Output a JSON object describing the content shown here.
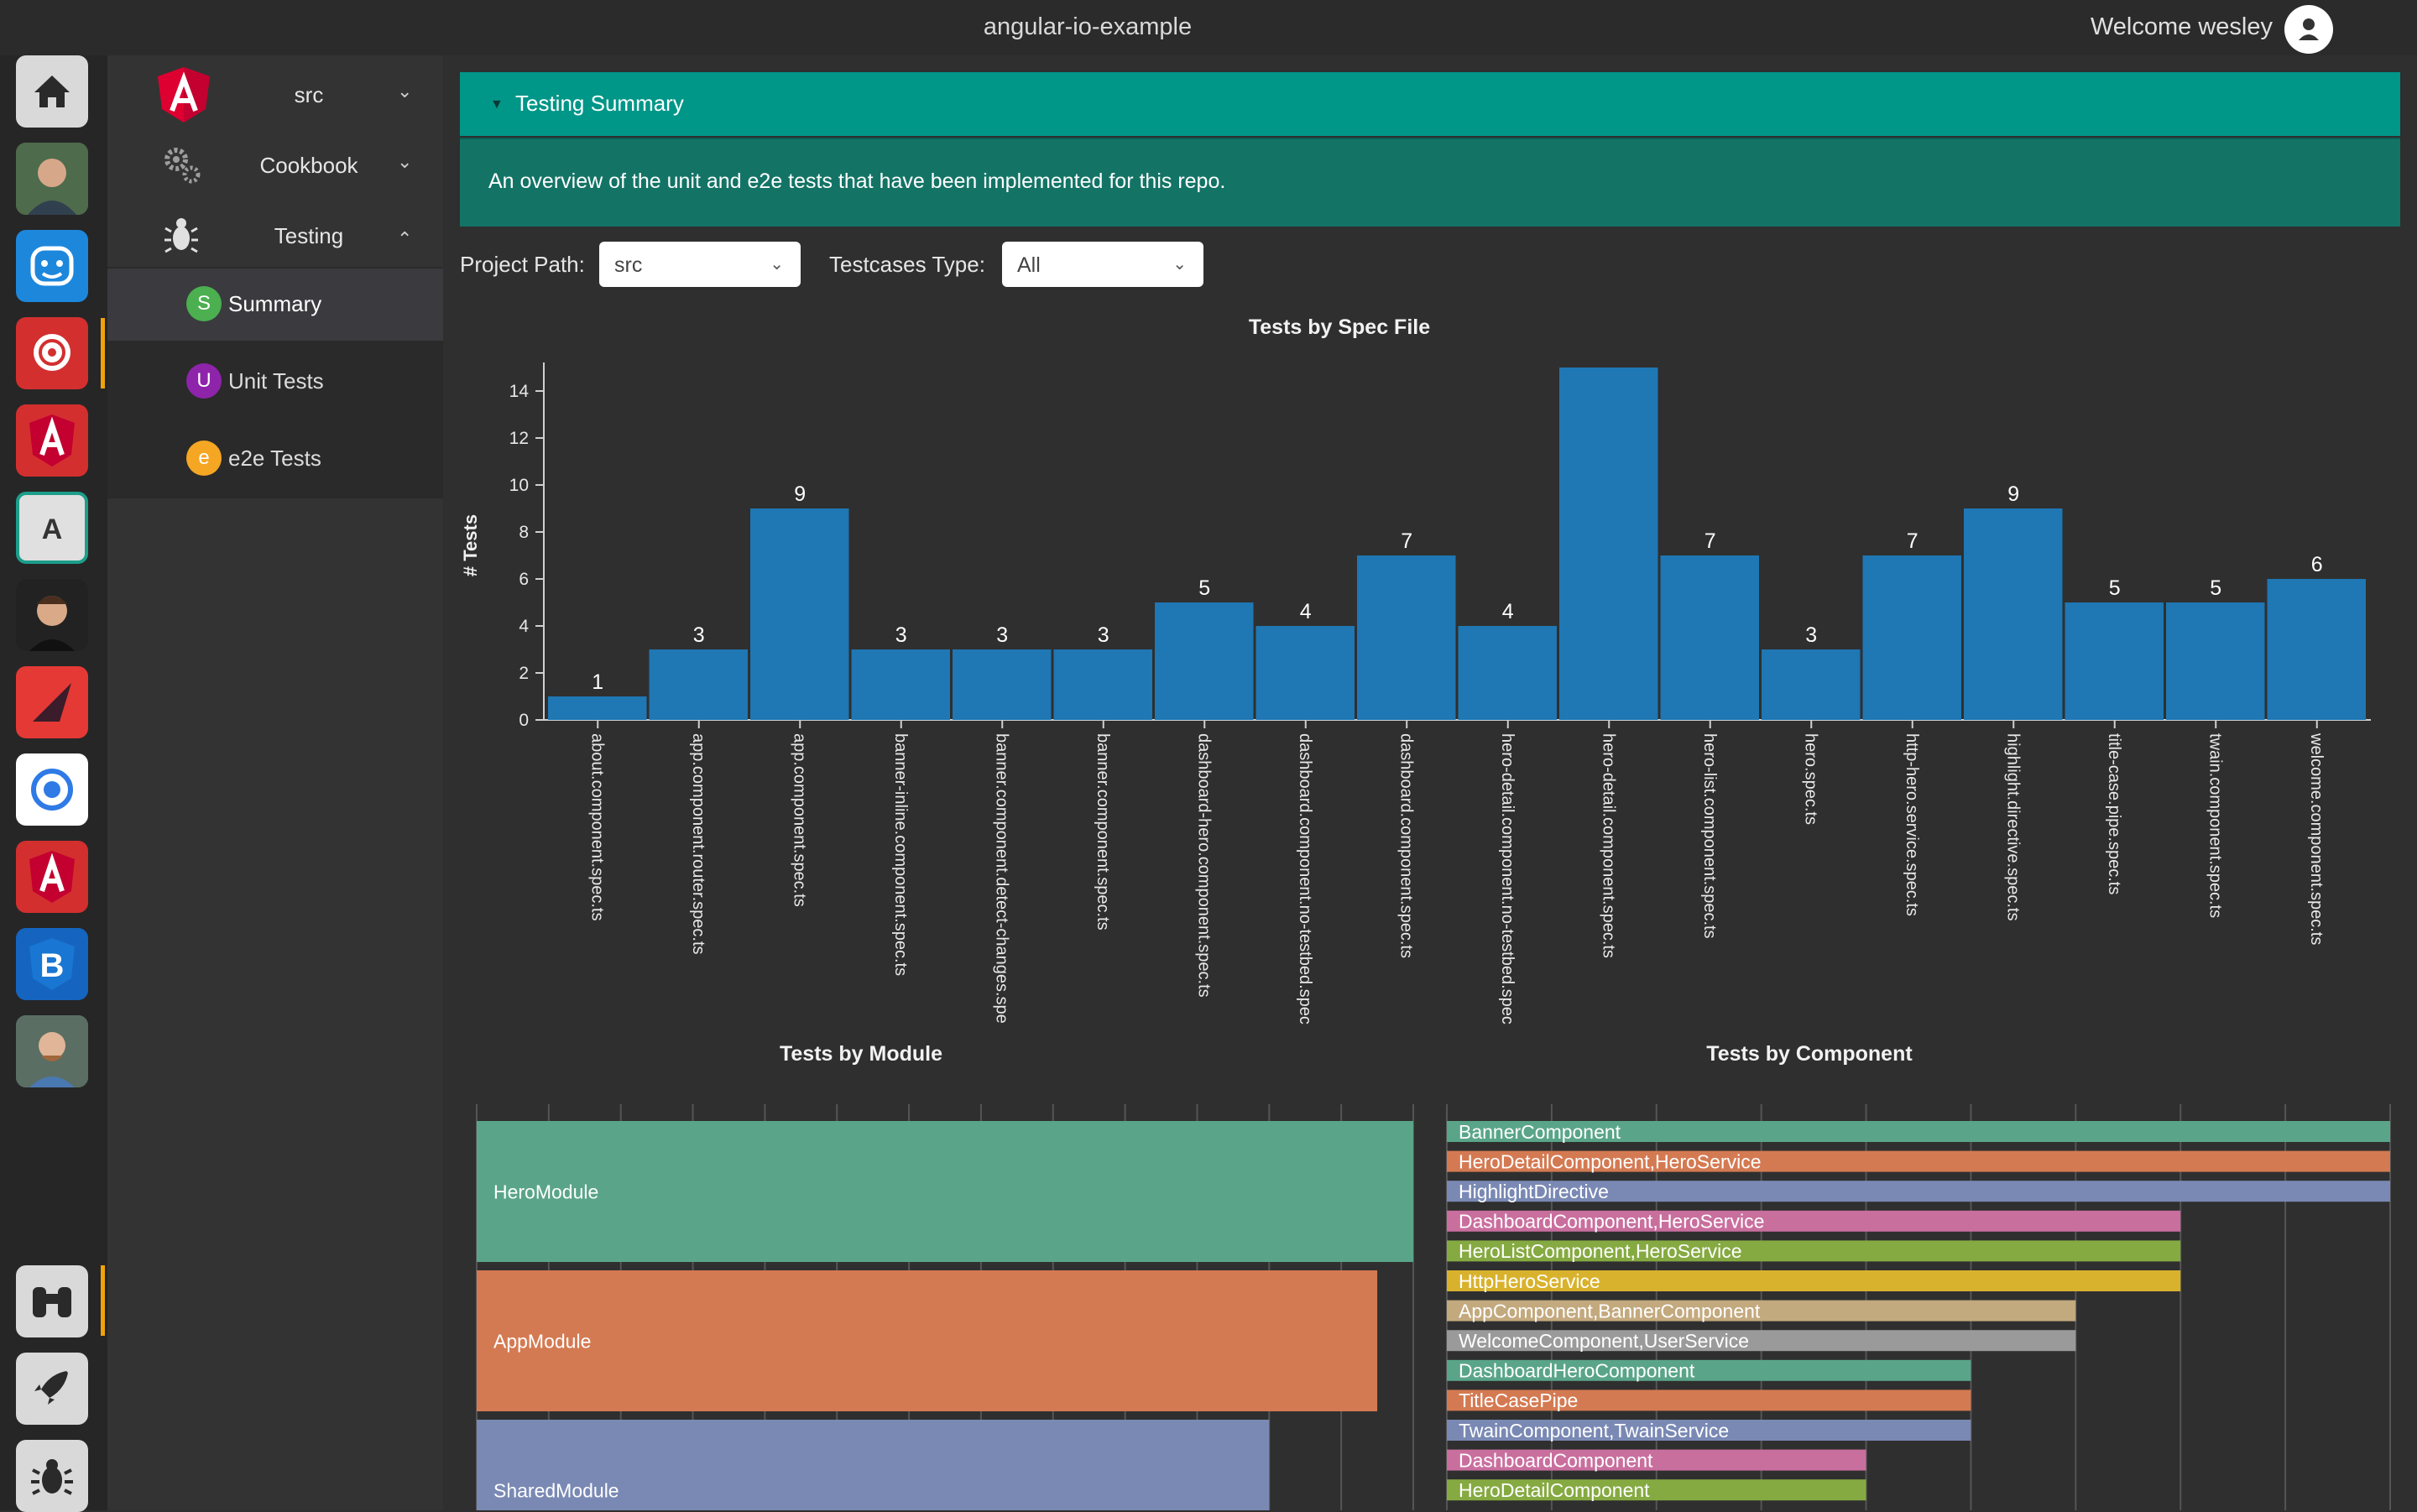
{
  "window": {
    "title": "angular-io-example",
    "welcome": "Welcome wesley"
  },
  "rail": {
    "items": [
      {
        "name": "home-icon"
      },
      {
        "name": "avatar-1"
      },
      {
        "name": "robot-app-icon"
      },
      {
        "name": "at-app-icon"
      },
      {
        "name": "angular-app-icon"
      },
      {
        "name": "a-app-icon"
      },
      {
        "name": "avatar-2"
      },
      {
        "name": "triangle-app-icon"
      },
      {
        "name": "ring-app-icon"
      },
      {
        "name": "angular-app-icon-2"
      },
      {
        "name": "bootstrap-app-icon"
      },
      {
        "name": "avatar-3"
      }
    ],
    "bottom": [
      {
        "name": "binoculars-icon"
      },
      {
        "name": "rocket-icon"
      },
      {
        "name": "bug-icon"
      }
    ]
  },
  "nav": {
    "project": "src",
    "cookbook": "Cookbook",
    "testing": "Testing",
    "sub": [
      {
        "badge": "S",
        "label": "Summary",
        "color": "#4caf50"
      },
      {
        "badge": "U",
        "label": "Unit Tests",
        "color": "#8e24aa"
      },
      {
        "badge": "e",
        "label": "e2e Tests",
        "color": "#f5a623"
      }
    ]
  },
  "summary": {
    "title": "Testing Summary",
    "description": "An overview of the unit and e2e tests that have been implemented for this repo."
  },
  "filters": {
    "project_path_label": "Project Path:",
    "project_path_value": "src",
    "testcases_type_label": "Testcases Type:",
    "testcases_type_value": "All"
  },
  "chart_data": [
    {
      "type": "bar",
      "title": "Tests by Spec File",
      "ylabel": "# Tests",
      "ylim": [
        0,
        15
      ],
      "yticks": [
        0,
        2,
        4,
        6,
        8,
        10,
        12,
        14
      ],
      "categories": [
        "about.component.spec.ts",
        "app.component.router.spec.ts",
        "app.component.spec.ts",
        "banner-inline.component.spec.ts",
        "banner.component.detect-changes.spe",
        "banner.component.spec.ts",
        "dashboard-hero.component.spec.ts",
        "dashboard.component.no-testbed.spec",
        "dashboard.component.spec.ts",
        "hero-detail.component.no-testbed.spec",
        "hero-detail.component.spec.ts",
        "hero-list.component.spec.ts",
        "hero.spec.ts",
        "http-hero.service.spec.ts",
        "highlight.directive.spec.ts",
        "title-case.pipe.spec.ts",
        "twain.component.spec.ts",
        "welcome.component.spec.ts"
      ],
      "values": [
        1,
        3,
        9,
        3,
        3,
        3,
        5,
        4,
        7,
        4,
        15,
        7,
        3,
        7,
        9,
        5,
        5,
        6
      ],
      "labels": [
        "1",
        "3",
        "9",
        "3",
        "3",
        "3",
        "5",
        "4",
        "7",
        "4",
        "",
        "7",
        "3",
        "7",
        "9",
        "5",
        "5",
        "6"
      ],
      "color": "#1f77b4"
    },
    {
      "type": "bar",
      "title": "Tests by Module",
      "orientation": "horizontal",
      "xlim": [
        0,
        13
      ],
      "categories": [
        "HeroModule",
        "AppModule",
        "SharedModule"
      ],
      "values": [
        13,
        12.5,
        11
      ],
      "colors": [
        "#5aa58a",
        "#d47a52",
        "#7a89b4"
      ]
    },
    {
      "type": "bar",
      "title": "Tests by Component",
      "orientation": "horizontal",
      "xlim": [
        0,
        9
      ],
      "categories": [
        "BannerComponent",
        "HeroDetailComponent,HeroService",
        "HighlightDirective",
        "DashboardComponent,HeroService",
        "HeroListComponent,HeroService",
        "HttpHeroService",
        "AppComponent,BannerComponent",
        "WelcomeComponent,UserService",
        "DashboardHeroComponent",
        "TitleCasePipe",
        "TwainComponent,TwainService",
        "DashboardComponent",
        "HeroDetailComponent"
      ],
      "values": [
        9,
        9,
        9,
        7,
        7,
        7,
        6,
        6,
        5,
        5,
        5,
        4,
        4
      ],
      "colors": [
        "#5aa58a",
        "#d47a52",
        "#7a89b4",
        "#c96f9e",
        "#86aa42",
        "#d9b22d",
        "#c3a97e",
        "#9a9a9a",
        "#5aa58a",
        "#d47a52",
        "#7a89b4",
        "#c96f9e",
        "#86aa42"
      ]
    }
  ]
}
